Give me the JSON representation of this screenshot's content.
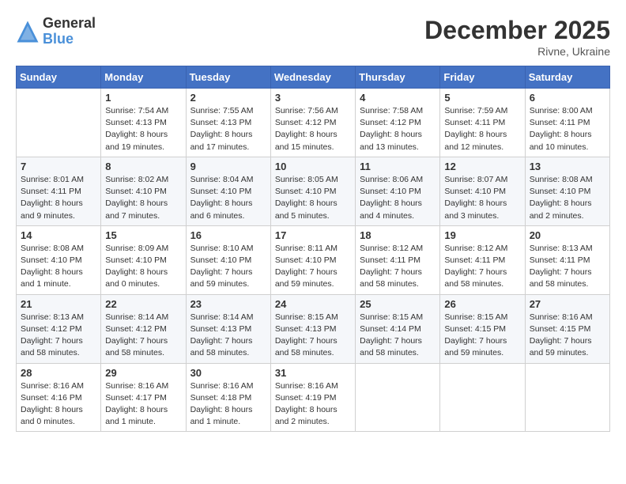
{
  "header": {
    "logo_general": "General",
    "logo_blue": "Blue",
    "month": "December 2025",
    "location": "Rivne, Ukraine"
  },
  "weekdays": [
    "Sunday",
    "Monday",
    "Tuesday",
    "Wednesday",
    "Thursday",
    "Friday",
    "Saturday"
  ],
  "weeks": [
    [
      {
        "day": "",
        "sunrise": "",
        "sunset": "",
        "daylight": ""
      },
      {
        "day": "1",
        "sunrise": "Sunrise: 7:54 AM",
        "sunset": "Sunset: 4:13 PM",
        "daylight": "Daylight: 8 hours and 19 minutes."
      },
      {
        "day": "2",
        "sunrise": "Sunrise: 7:55 AM",
        "sunset": "Sunset: 4:13 PM",
        "daylight": "Daylight: 8 hours and 17 minutes."
      },
      {
        "day": "3",
        "sunrise": "Sunrise: 7:56 AM",
        "sunset": "Sunset: 4:12 PM",
        "daylight": "Daylight: 8 hours and 15 minutes."
      },
      {
        "day": "4",
        "sunrise": "Sunrise: 7:58 AM",
        "sunset": "Sunset: 4:12 PM",
        "daylight": "Daylight: 8 hours and 13 minutes."
      },
      {
        "day": "5",
        "sunrise": "Sunrise: 7:59 AM",
        "sunset": "Sunset: 4:11 PM",
        "daylight": "Daylight: 8 hours and 12 minutes."
      },
      {
        "day": "6",
        "sunrise": "Sunrise: 8:00 AM",
        "sunset": "Sunset: 4:11 PM",
        "daylight": "Daylight: 8 hours and 10 minutes."
      }
    ],
    [
      {
        "day": "7",
        "sunrise": "Sunrise: 8:01 AM",
        "sunset": "Sunset: 4:11 PM",
        "daylight": "Daylight: 8 hours and 9 minutes."
      },
      {
        "day": "8",
        "sunrise": "Sunrise: 8:02 AM",
        "sunset": "Sunset: 4:10 PM",
        "daylight": "Daylight: 8 hours and 7 minutes."
      },
      {
        "day": "9",
        "sunrise": "Sunrise: 8:04 AM",
        "sunset": "Sunset: 4:10 PM",
        "daylight": "Daylight: 8 hours and 6 minutes."
      },
      {
        "day": "10",
        "sunrise": "Sunrise: 8:05 AM",
        "sunset": "Sunset: 4:10 PM",
        "daylight": "Daylight: 8 hours and 5 minutes."
      },
      {
        "day": "11",
        "sunrise": "Sunrise: 8:06 AM",
        "sunset": "Sunset: 4:10 PM",
        "daylight": "Daylight: 8 hours and 4 minutes."
      },
      {
        "day": "12",
        "sunrise": "Sunrise: 8:07 AM",
        "sunset": "Sunset: 4:10 PM",
        "daylight": "Daylight: 8 hours and 3 minutes."
      },
      {
        "day": "13",
        "sunrise": "Sunrise: 8:08 AM",
        "sunset": "Sunset: 4:10 PM",
        "daylight": "Daylight: 8 hours and 2 minutes."
      }
    ],
    [
      {
        "day": "14",
        "sunrise": "Sunrise: 8:08 AM",
        "sunset": "Sunset: 4:10 PM",
        "daylight": "Daylight: 8 hours and 1 minute."
      },
      {
        "day": "15",
        "sunrise": "Sunrise: 8:09 AM",
        "sunset": "Sunset: 4:10 PM",
        "daylight": "Daylight: 8 hours and 0 minutes."
      },
      {
        "day": "16",
        "sunrise": "Sunrise: 8:10 AM",
        "sunset": "Sunset: 4:10 PM",
        "daylight": "Daylight: 7 hours and 59 minutes."
      },
      {
        "day": "17",
        "sunrise": "Sunrise: 8:11 AM",
        "sunset": "Sunset: 4:10 PM",
        "daylight": "Daylight: 7 hours and 59 minutes."
      },
      {
        "day": "18",
        "sunrise": "Sunrise: 8:12 AM",
        "sunset": "Sunset: 4:11 PM",
        "daylight": "Daylight: 7 hours and 58 minutes."
      },
      {
        "day": "19",
        "sunrise": "Sunrise: 8:12 AM",
        "sunset": "Sunset: 4:11 PM",
        "daylight": "Daylight: 7 hours and 58 minutes."
      },
      {
        "day": "20",
        "sunrise": "Sunrise: 8:13 AM",
        "sunset": "Sunset: 4:11 PM",
        "daylight": "Daylight: 7 hours and 58 minutes."
      }
    ],
    [
      {
        "day": "21",
        "sunrise": "Sunrise: 8:13 AM",
        "sunset": "Sunset: 4:12 PM",
        "daylight": "Daylight: 7 hours and 58 minutes."
      },
      {
        "day": "22",
        "sunrise": "Sunrise: 8:14 AM",
        "sunset": "Sunset: 4:12 PM",
        "daylight": "Daylight: 7 hours and 58 minutes."
      },
      {
        "day": "23",
        "sunrise": "Sunrise: 8:14 AM",
        "sunset": "Sunset: 4:13 PM",
        "daylight": "Daylight: 7 hours and 58 minutes."
      },
      {
        "day": "24",
        "sunrise": "Sunrise: 8:15 AM",
        "sunset": "Sunset: 4:13 PM",
        "daylight": "Daylight: 7 hours and 58 minutes."
      },
      {
        "day": "25",
        "sunrise": "Sunrise: 8:15 AM",
        "sunset": "Sunset: 4:14 PM",
        "daylight": "Daylight: 7 hours and 58 minutes."
      },
      {
        "day": "26",
        "sunrise": "Sunrise: 8:15 AM",
        "sunset": "Sunset: 4:15 PM",
        "daylight": "Daylight: 7 hours and 59 minutes."
      },
      {
        "day": "27",
        "sunrise": "Sunrise: 8:16 AM",
        "sunset": "Sunset: 4:15 PM",
        "daylight": "Daylight: 7 hours and 59 minutes."
      }
    ],
    [
      {
        "day": "28",
        "sunrise": "Sunrise: 8:16 AM",
        "sunset": "Sunset: 4:16 PM",
        "daylight": "Daylight: 8 hours and 0 minutes."
      },
      {
        "day": "29",
        "sunrise": "Sunrise: 8:16 AM",
        "sunset": "Sunset: 4:17 PM",
        "daylight": "Daylight: 8 hours and 1 minute."
      },
      {
        "day": "30",
        "sunrise": "Sunrise: 8:16 AM",
        "sunset": "Sunset: 4:18 PM",
        "daylight": "Daylight: 8 hours and 1 minute."
      },
      {
        "day": "31",
        "sunrise": "Sunrise: 8:16 AM",
        "sunset": "Sunset: 4:19 PM",
        "daylight": "Daylight: 8 hours and 2 minutes."
      },
      {
        "day": "",
        "sunrise": "",
        "sunset": "",
        "daylight": ""
      },
      {
        "day": "",
        "sunrise": "",
        "sunset": "",
        "daylight": ""
      },
      {
        "day": "",
        "sunrise": "",
        "sunset": "",
        "daylight": ""
      }
    ]
  ]
}
